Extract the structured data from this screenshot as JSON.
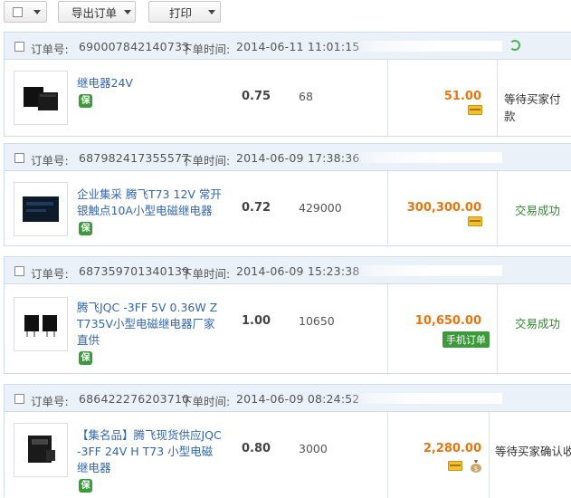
{
  "toolbar": {
    "export_label": "导出订单",
    "print_label": "打印"
  },
  "labels": {
    "order_no": "订单号:",
    "order_time": "下单时间:",
    "shield": "保"
  },
  "orders": [
    {
      "order_no": "690007842140733",
      "order_time": "2014-06-11 11:01:15",
      "product_name": "继电器24V",
      "unit_price": "0.75",
      "quantity": "68",
      "total": "51.00",
      "status": "等待买家付款",
      "status_color": "#333333"
    },
    {
      "order_no": "687982417355577",
      "order_time": "2014-06-09 17:38:36",
      "product_name": "企业集采 腾飞T73 12V 常开银触点10A小型电磁继电器",
      "unit_price": "0.72",
      "quantity": "429000",
      "total": "300,300.00",
      "status": "交易成功",
      "status_color": "#2e8b2e"
    },
    {
      "order_no": "687359701340139",
      "order_time": "2014-06-09 15:23:38",
      "product_name": "腾飞JQC -3FF 5V 0.36W Z T735V小型电磁继电器厂家直供",
      "unit_price": "1.00",
      "quantity": "10650",
      "total": "10,650.00",
      "status": "交易成功",
      "status_color": "#2e8b2e",
      "tag": "手机订单"
    },
    {
      "order_no": "686422276203710",
      "order_time": "2014-06-09 08:24:52",
      "product_name": "【集名品】腾飞现货供应JQC -3FF 24V H T73 小型电磁继电器",
      "unit_price": "0.80",
      "quantity": "3000",
      "total": "2,280.00",
      "status": "等待买家确认收货",
      "status_color": "#333333"
    }
  ]
}
